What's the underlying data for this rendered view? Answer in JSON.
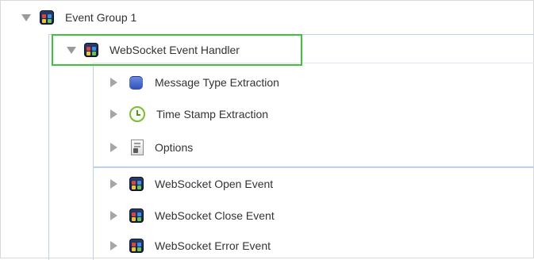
{
  "tree": {
    "root": {
      "label": "Event Group 1",
      "icon": "app-icon",
      "expanded": true
    },
    "handler": {
      "label": "WebSocket Event Handler",
      "icon": "app-icon",
      "expanded": true,
      "selected": true,
      "highlight_color": "#3cc43c"
    },
    "handler_children": [
      {
        "label": "Message Type Extraction",
        "icon": "blue-square-icon"
      },
      {
        "label": "Time Stamp Extraction",
        "icon": "clock-icon"
      },
      {
        "label": "Options",
        "icon": "options-doc-icon"
      }
    ],
    "events": [
      {
        "label": "WebSocket Open Event",
        "icon": "app-icon"
      },
      {
        "label": "WebSocket Close Event",
        "icon": "app-icon"
      },
      {
        "label": "WebSocket Error Event",
        "icon": "app-icon"
      }
    ]
  },
  "colors": {
    "panel_border": "#b9d4ee",
    "selection_border": "#3cc43c",
    "disclosure": "#9a9a9a"
  }
}
